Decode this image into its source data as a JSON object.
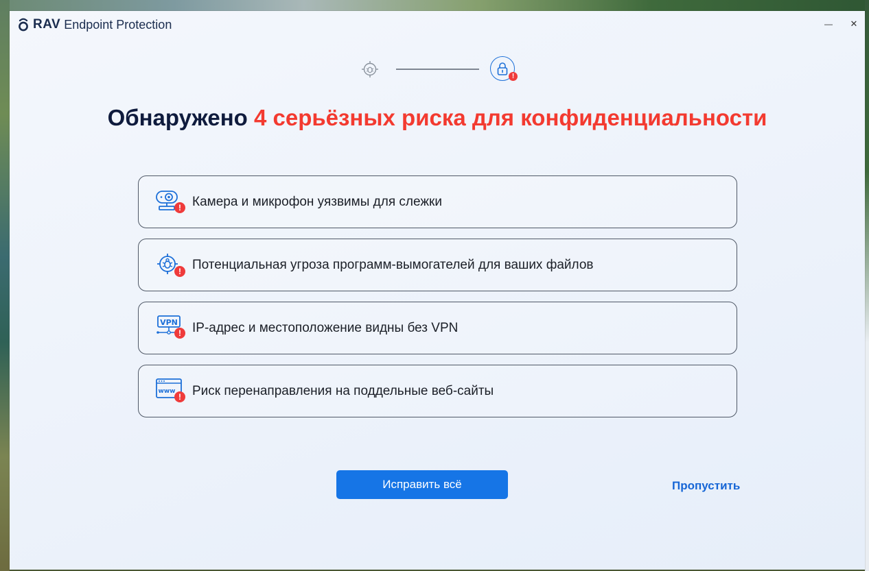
{
  "app": {
    "brand_short": "RAV",
    "brand_name": "Endpoint Protection"
  },
  "window_controls": {
    "minimize": "—",
    "close": "✕"
  },
  "stepper": {
    "step1_icon": "bug-scan-icon",
    "step2_icon": "lock-icon",
    "step2_badge": "!"
  },
  "heading": {
    "prefix": "Обнаружено",
    "accent": "4 серьёзных риска для конфиденциальности"
  },
  "risks": [
    {
      "icon": "webcam-icon",
      "badge": "!",
      "text": "Камера и микрофон уязвимы для слежки"
    },
    {
      "icon": "ransomware-bug-icon",
      "badge": "!",
      "text": "Потенциальная угроза программ-вымогателей для ваших файлов"
    },
    {
      "icon": "vpn-icon",
      "badge": "!",
      "text": "IP-адрес и местоположение видны без VPN"
    },
    {
      "icon": "www-browser-icon",
      "badge": "!",
      "text": "Риск перенаправления на поддельные веб-сайты"
    }
  ],
  "actions": {
    "fix_all": "Исправить всё",
    "skip": "Пропустить"
  },
  "colors": {
    "accent_red": "#f33a30",
    "primary_blue": "#1675e6",
    "link_blue": "#1666d6",
    "heading_dark": "#0f1b3d"
  }
}
